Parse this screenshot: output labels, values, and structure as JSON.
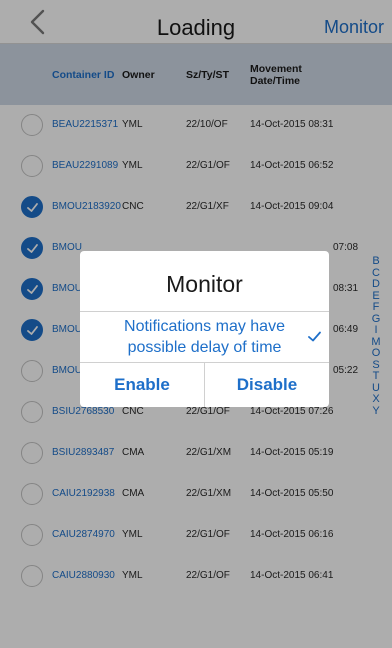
{
  "nav": {
    "title": "Loading",
    "right": "Monitor"
  },
  "table": {
    "headers": {
      "container_id": "Container ID",
      "owner": "Owner",
      "size_type": "Sz/Ty/ST",
      "movement_1": "Movement",
      "movement_2": "Date/Time"
    },
    "rows": [
      {
        "checked": false,
        "id": "BEAU2215371",
        "owner": "YML",
        "sz": "22/10/OF",
        "dt": "14-Oct-2015 08:31"
      },
      {
        "checked": false,
        "id": "BEAU2291089",
        "owner": "YML",
        "sz": "22/G1/OF",
        "dt": "14-Oct-2015 06:52"
      },
      {
        "checked": true,
        "id": "BMOU2183920",
        "owner": "CNC",
        "sz": "22/G1/XF",
        "dt": "14-Oct-2015 09:04"
      },
      {
        "checked": true,
        "id": "BMOU",
        "owner": "",
        "sz": "",
        "dt": "07:08"
      },
      {
        "checked": true,
        "id": "BMOU",
        "owner": "",
        "sz": "",
        "dt": "08:31"
      },
      {
        "checked": true,
        "id": "BMOU",
        "owner": "",
        "sz": "",
        "dt": "06:49"
      },
      {
        "checked": false,
        "id": "BMOU",
        "owner": "",
        "sz": "",
        "dt": "05:22"
      },
      {
        "checked": false,
        "id": "BSIU2768530",
        "owner": "CNC",
        "sz": "22/G1/OF",
        "dt": "14-Oct-2015 07:26"
      },
      {
        "checked": false,
        "id": "BSIU2893487",
        "owner": "CMA",
        "sz": "22/G1/XM",
        "dt": "14-Oct-2015 05:19"
      },
      {
        "checked": false,
        "id": "CAIU2192938",
        "owner": "CMA",
        "sz": "22/G1/XM",
        "dt": "14-Oct-2015 05:50"
      },
      {
        "checked": false,
        "id": "CAIU2874970",
        "owner": "YML",
        "sz": "22/G1/OF",
        "dt": "14-Oct-2015 06:16"
      },
      {
        "checked": false,
        "id": "CAIU2880930",
        "owner": "YML",
        "sz": "22/G1/OF",
        "dt": "14-Oct-2015 06:41"
      }
    ]
  },
  "index_letters": [
    "B",
    "C",
    "D",
    "E",
    "F",
    "G",
    "I",
    "M",
    "O",
    "S",
    "T",
    "U",
    "X",
    "Y"
  ],
  "dialog": {
    "title": "Monitor",
    "message_line1": "Notifications may have",
    "message_line2": "possible delay of time",
    "option_checked": true,
    "enable_label": "Enable",
    "disable_label": "Disable"
  },
  "icons": {
    "back": "chevron-left-icon",
    "row_check": "checkmark-icon",
    "option_check": "checkmark-icon"
  },
  "colors": {
    "accent": "#1e6fc9",
    "header_bg": "#cfd9e6",
    "overlay": "rgba(0,0,0,0.32)"
  }
}
